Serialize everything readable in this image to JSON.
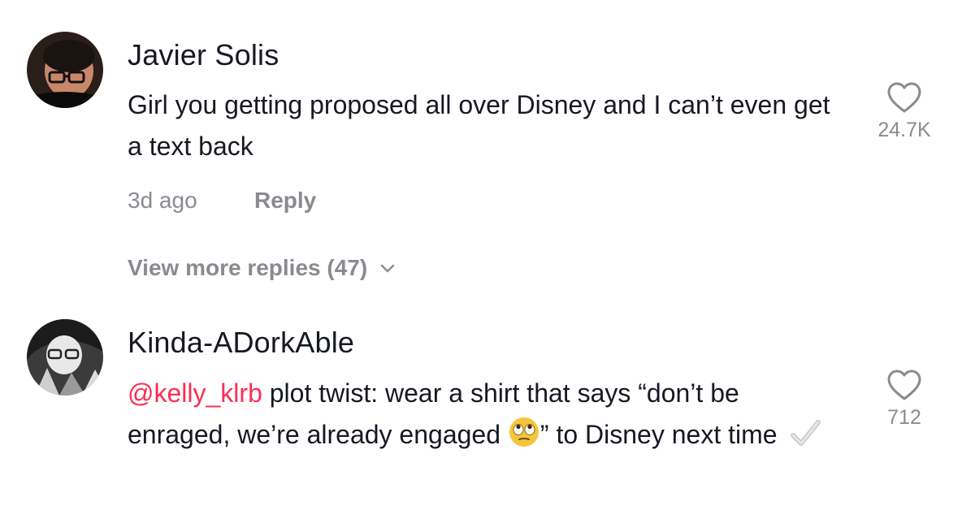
{
  "comments": [
    {
      "author": "Javier Solis",
      "text": "Girl you getting proposed all over Disney and I can’t even get a text back",
      "time": "3d ago",
      "reply_label": "Reply",
      "likes": "24.7K",
      "view_more": "View more replies (47)"
    },
    {
      "author": "Kinda-ADorkAble",
      "mention": "@kelly_klrb",
      "text_part1": " plot twist: wear a shirt that says “don’t be enraged, we’re already engaged ",
      "text_part2": "” to Disney next time ",
      "likes": "712"
    }
  ],
  "icons": {
    "like": "heart-outline-icon",
    "expand": "chevron-down-icon",
    "emoji": "face-with-rolling-eyes-emoji",
    "check": "check-mark-emoji"
  },
  "colors": {
    "mention": "#fe2c55",
    "muted": "#8a8b91",
    "text": "#161823"
  }
}
